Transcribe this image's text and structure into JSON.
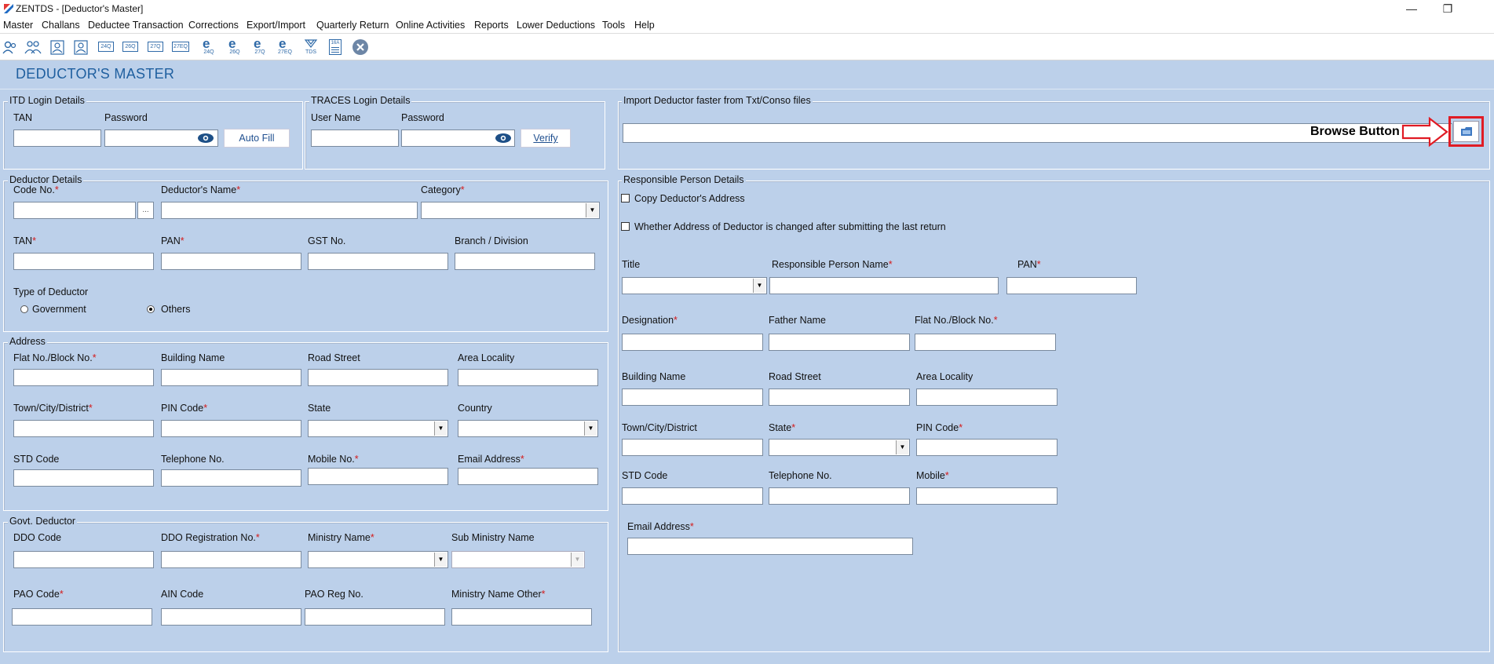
{
  "window": {
    "title": "ZENTDS - [Deductor's Master]",
    "minimize": "—",
    "restore": "❐"
  },
  "menu": [
    "Master",
    "Challans",
    "Deductee Transaction",
    "Corrections",
    "Export/Import",
    "Quarterly Return",
    "Online Activities",
    "Reports",
    "Lower Deductions",
    "Tools",
    "Help"
  ],
  "toolbar_icons": [
    "deductor-icon",
    "deductees-icon",
    "employee-icon",
    "employee-2-icon",
    "form-24q-icon",
    "form-26q-icon",
    "form-27q-icon",
    "form-27eq-icon",
    "e-24q-icon",
    "e-26q-icon",
    "e-27q-icon",
    "e-27eq-icon",
    "tds-icon",
    "certificate-icon",
    "close-circle-icon"
  ],
  "toolbar_labels": [
    "24Q",
    "26Q",
    "27Q",
    "27EQ",
    "24Q",
    "26Q",
    "27Q",
    "27EQ",
    "TDS",
    "16A"
  ],
  "page_title": "DEDUCTOR'S MASTER",
  "itd": {
    "legend": "ITD Login Details",
    "tan_label": "TAN",
    "password_label": "Password",
    "autofill": "Auto Fill"
  },
  "traces": {
    "legend": "TRACES Login Details",
    "user_label": "User Name",
    "password_label": "Password",
    "verify": "Verify"
  },
  "import": {
    "legend": "Import Deductor faster from Txt/Conso files",
    "annotation": "Browse Button"
  },
  "deductor": {
    "legend": "Deductor Details",
    "code_label": "Code No.",
    "name_label": "Deductor's Name",
    "category_label": "Category",
    "tan_label": "TAN",
    "pan_label": "PAN",
    "gst_label": "GST No.",
    "branch_label": "Branch / Division",
    "type_label": "Type of Deductor",
    "type_gov": "Government",
    "type_others": "Others",
    "ellipsis": "..."
  },
  "address": {
    "legend": "Address",
    "flat": "Flat No./Block No.",
    "building": "Building Name",
    "road": "Road Street",
    "area": "Area Locality",
    "town": "Town/City/District",
    "pin": "PIN Code",
    "state": "State",
    "country": "Country",
    "std": "STD Code",
    "tel": "Telephone No.",
    "mobile": "Mobile No.",
    "email": "Email Address"
  },
  "govt": {
    "legend": "Govt. Deductor",
    "ddo": "DDO Code",
    "ddo_reg": "DDO Registration No.",
    "ministry": "Ministry Name",
    "sub_ministry": "Sub Ministry Name",
    "pao": "PAO Code",
    "ain": "AIN Code",
    "pao_reg": "PAO Reg No.",
    "ministry_other": "Ministry Name Other"
  },
  "resp": {
    "legend": "Responsible Person Details",
    "copy_addr": "Copy Deductor's Address",
    "addr_changed": "Whether Address of Deductor is changed after submitting the last return",
    "title": "Title",
    "name": "Responsible Person Name",
    "pan": "PAN",
    "designation": "Designation",
    "father": "Father Name",
    "flat": "Flat No./Block No.",
    "building": "Building Name",
    "road": "Road Street",
    "area": "Area Locality",
    "town": "Town/City/District",
    "state": "State",
    "pin": "PIN Code",
    "std": "STD Code",
    "tel": "Telephone No.",
    "mobile": "Mobile",
    "email": "Email Address"
  },
  "required_mark": "*",
  "colors": {
    "page_bg": "#bcd0ea",
    "title": "#1f5f9f",
    "required": "#d41a1a",
    "annotation": "#e01b24"
  }
}
